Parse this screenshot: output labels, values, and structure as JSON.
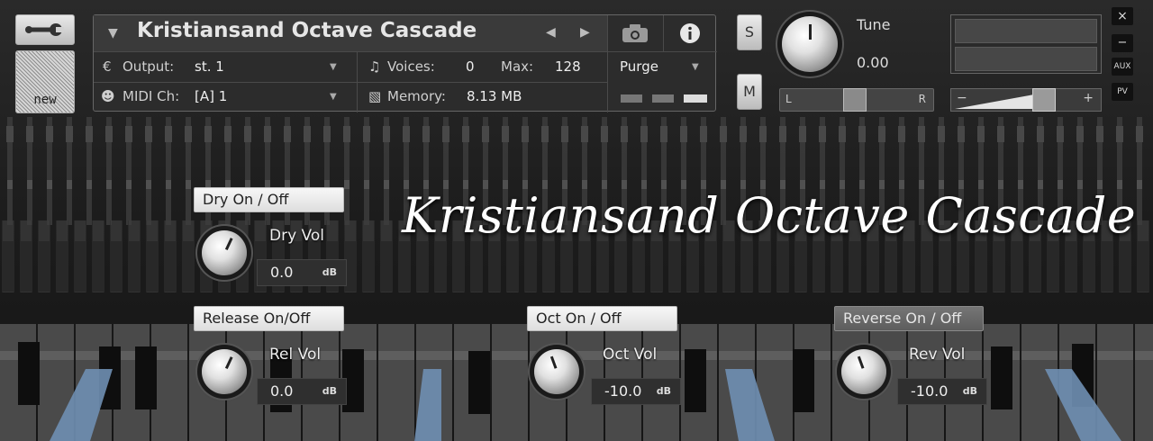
{
  "header": {
    "instrument_name": "Kristiansand Octave Cascade",
    "new_label": "new",
    "output_label": "Output:",
    "output_value": "st. 1",
    "voices_label": "Voices:",
    "voices_value": "0",
    "max_label": "Max:",
    "max_value": "128",
    "purge_label": "Purge",
    "midi_label": "MIDI Ch:",
    "midi_value": "[A]  1",
    "memory_label": "Memory:",
    "memory_value": "8.13 MB",
    "solo_label": "S",
    "mute_label": "M",
    "tune_label": "Tune",
    "tune_value": "0.00",
    "pan_left": "L",
    "pan_right": "R",
    "vol_minus": "−",
    "vol_plus": "+",
    "close": "×",
    "minimize": "−",
    "aux": "AUX",
    "pv": "PV",
    "icons": [
      "wrench-icon",
      "dropdown-arrow-icon",
      "prev-icon",
      "next-icon",
      "camera-icon",
      "info-icon",
      "output-icon",
      "voices-icon",
      "midi-icon",
      "memory-icon"
    ]
  },
  "instrument": {
    "script_title": "Kristiansand Octave Cascade",
    "dry": {
      "toggle": "Dry On / Off",
      "label": "Dry Vol",
      "value": "0.0",
      "unit": "dB"
    },
    "release": {
      "toggle": "Release On/Off",
      "label": "Rel Vol",
      "value": "0.0",
      "unit": "dB"
    },
    "octave": {
      "toggle": "Oct On / Off",
      "label": "Oct Vol",
      "value": "-10.0",
      "unit": "dB"
    },
    "reverse": {
      "toggle": "Reverse On / Off",
      "label": "Rev Vol",
      "value": "-10.0",
      "unit": "dB"
    }
  },
  "colors": {
    "accent_key": "#6f8fb3",
    "panel": "#2c2c2c"
  }
}
